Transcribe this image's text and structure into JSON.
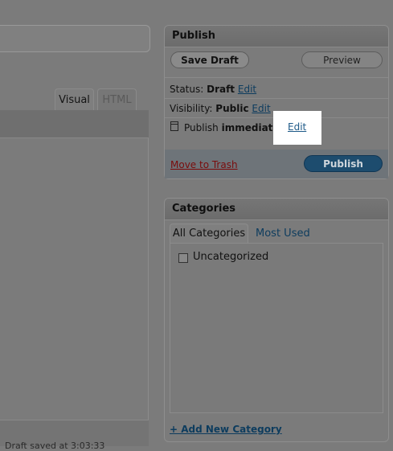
{
  "editor": {
    "tabs": [
      "Visual",
      "HTML"
    ],
    "draft_saved": "Draft saved at 3:03:33"
  },
  "publish": {
    "title": "Publish",
    "save_draft": "Save Draft",
    "preview": "Preview",
    "status_label": "Status:",
    "status_value": "Draft",
    "visibility_label": "Visibility:",
    "visibility_value": "Public",
    "publish_label": "Publish",
    "publish_value": "immediately",
    "edit": "Edit",
    "move_to_trash": "Move to Trash",
    "publish_button": "Publish"
  },
  "categories": {
    "title": "Categories",
    "tab_all": "All Categories",
    "tab_most_used": "Most Used",
    "items": [
      "Uncategorized"
    ],
    "add_new": "+ Add New Category"
  },
  "icons": {
    "calendar": "calendar-icon"
  },
  "colors": {
    "publish_button": "#1d4c6e",
    "trash_link": "#7a0c0c",
    "link": "#0d3c5e"
  }
}
